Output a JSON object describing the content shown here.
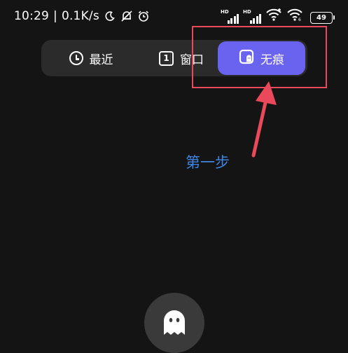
{
  "status_bar": {
    "time": "10:29",
    "separator": "|",
    "network_speed": "0.1K/s",
    "icons": [
      "moon-icon",
      "mute-icon",
      "alarm-icon",
      "signal-hd-icon",
      "signal-hd-icon",
      "wifi-icon",
      "wifi-6-icon"
    ],
    "signal_label_1": "HD",
    "signal_label_2": "HD",
    "battery": "49"
  },
  "tabs": {
    "items": [
      {
        "label": "最近",
        "icon": "clock-icon",
        "active": false
      },
      {
        "label": "窗口",
        "icon": "window-count-icon",
        "icon_text": "1",
        "active": false
      },
      {
        "label": "无痕",
        "icon": "incognito-icon",
        "active": true
      }
    ]
  },
  "annotation": {
    "step_label": "第一步",
    "color": "#e9495a",
    "label_color": "#3f84e0"
  },
  "colors": {
    "background": "#141414",
    "tab_bar": "#2b2b2c",
    "active_tab": "#6a63ef"
  },
  "fab": {
    "icon": "ghost-icon"
  }
}
